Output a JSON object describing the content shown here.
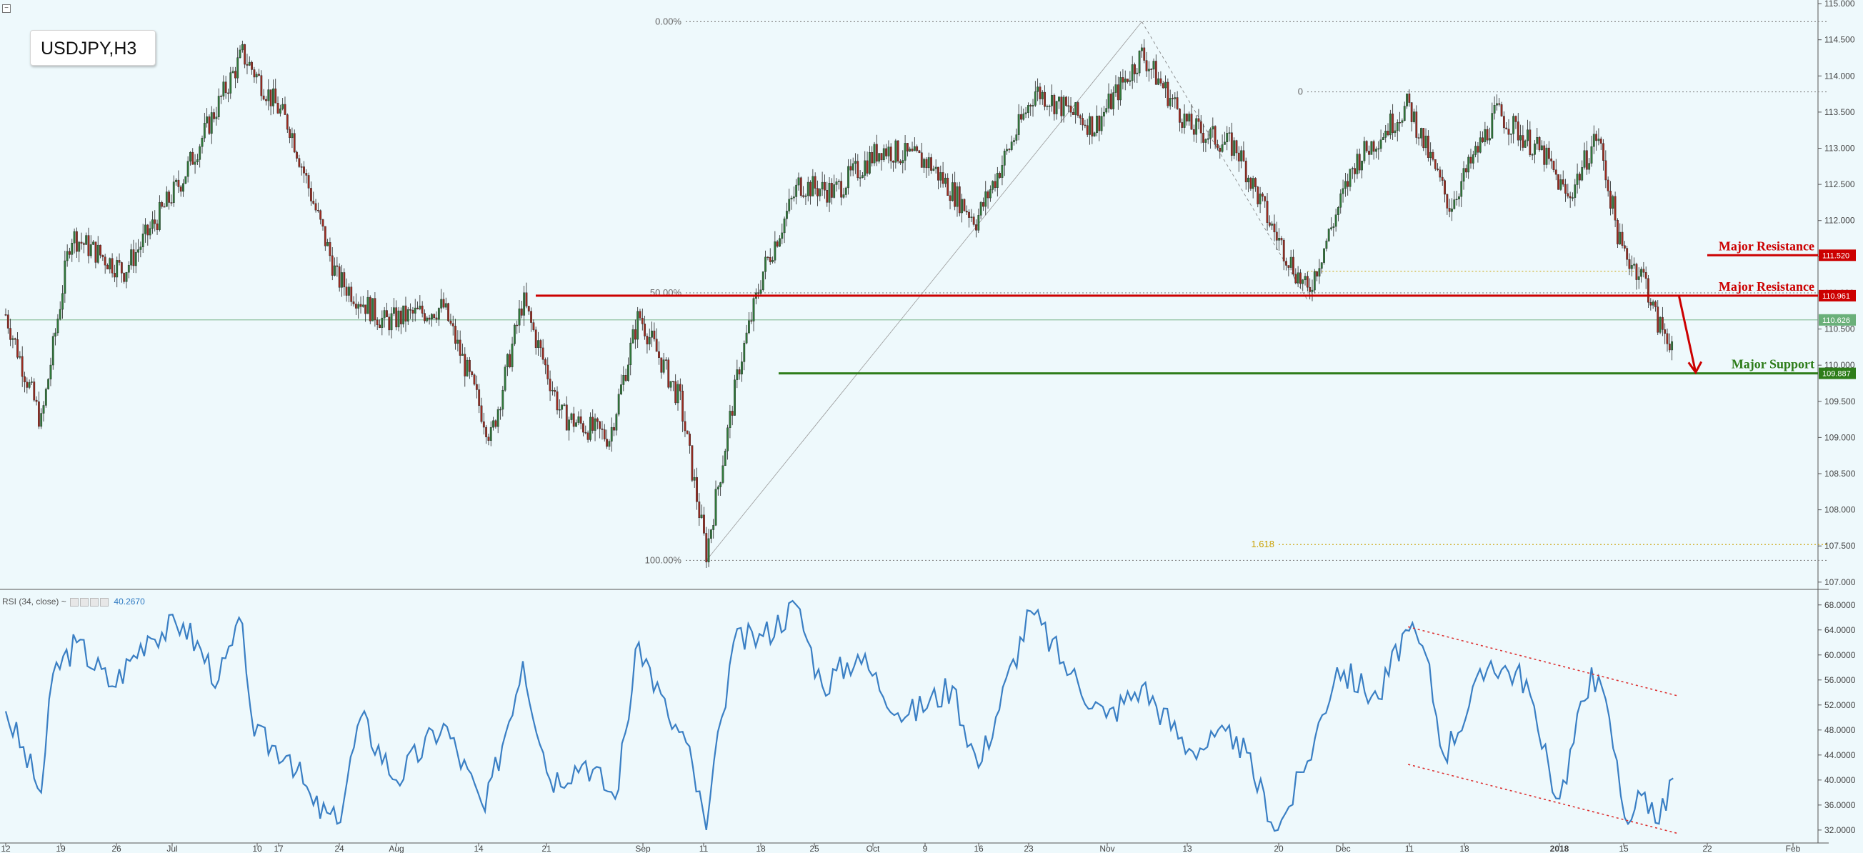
{
  "legend": {
    "symbol": "USDJPY,H3"
  },
  "rsi_panel": {
    "label": "RSI (34, close)",
    "separator": "~",
    "value": "40.2670"
  },
  "colors": {
    "background": "#eef9fc",
    "resistance": "#cc0000",
    "support": "#2e7d1a",
    "fib": "#c9a000",
    "rsi": "#3a7fc4",
    "candle_up": "#2f7a3a",
    "candle_down": "#9c2b20"
  },
  "chart_data": [
    {
      "type": "candlestick",
      "symbol": "USDJPY",
      "timeframe": "H3",
      "ylim": [
        106.85,
        115.05
      ],
      "y_ticks": [
        "115.000",
        "114.500",
        "114.000",
        "113.500",
        "113.000",
        "112.500",
        "112.000",
        "111.500",
        "111.000",
        "110.500",
        "110.000",
        "109.500",
        "109.000",
        "108.500",
        "108.000",
        "107.500",
        "107.000"
      ],
      "x_ticks": [
        "12",
        "19",
        "26",
        "Jul",
        "10",
        "17",
        "24",
        "Aug",
        "14",
        "21",
        "Sep",
        "11",
        "18",
        "25",
        "Oct",
        "9",
        "16",
        "23",
        "Nov",
        "13",
        "20",
        "Dec",
        "11",
        "18",
        "2018",
        "15",
        "22",
        "Feb"
      ],
      "close_series": [
        {
          "x": 0,
          "y": 110.7
        },
        {
          "x": 30,
          "y": 109.2
        },
        {
          "x": 55,
          "y": 111.8
        },
        {
          "x": 100,
          "y": 111.3
        },
        {
          "x": 150,
          "y": 112.6
        },
        {
          "x": 200,
          "y": 114.3
        },
        {
          "x": 240,
          "y": 113.3
        },
        {
          "x": 280,
          "y": 111.2
        },
        {
          "x": 320,
          "y": 110.6
        },
        {
          "x": 370,
          "y": 110.8
        },
        {
          "x": 410,
          "y": 109.0
        },
        {
          "x": 437,
          "y": 110.9
        },
        {
          "x": 470,
          "y": 109.3
        },
        {
          "x": 510,
          "y": 109.0
        },
        {
          "x": 535,
          "y": 110.7
        },
        {
          "x": 570,
          "y": 109.5
        },
        {
          "x": 592,
          "y": 107.4
        },
        {
          "x": 620,
          "y": 110.0
        },
        {
          "x": 640,
          "y": 111.3
        },
        {
          "x": 670,
          "y": 112.5
        },
        {
          "x": 700,
          "y": 112.4
        },
        {
          "x": 740,
          "y": 113.0
        },
        {
          "x": 780,
          "y": 112.8
        },
        {
          "x": 820,
          "y": 112.0
        },
        {
          "x": 870,
          "y": 113.8
        },
        {
          "x": 920,
          "y": 113.3
        },
        {
          "x": 960,
          "y": 114.3
        },
        {
          "x": 1000,
          "y": 113.3
        },
        {
          "x": 1040,
          "y": 113.0
        },
        {
          "x": 1070,
          "y": 111.9
        },
        {
          "x": 1100,
          "y": 111.0
        },
        {
          "x": 1140,
          "y": 112.8
        },
        {
          "x": 1185,
          "y": 113.6
        },
        {
          "x": 1220,
          "y": 112.2
        },
        {
          "x": 1260,
          "y": 113.5
        },
        {
          "x": 1300,
          "y": 112.9
        },
        {
          "x": 1320,
          "y": 112.3
        },
        {
          "x": 1345,
          "y": 113.2
        },
        {
          "x": 1365,
          "y": 111.6
        },
        {
          "x": 1385,
          "y": 111.2
        },
        {
          "x": 1395,
          "y": 110.6
        },
        {
          "x": 1409,
          "y": 110.3
        }
      ],
      "annotations": [
        {
          "text": "Major Resistance",
          "price": 111.52,
          "price_label": "111.520",
          "color": "#cc0000"
        },
        {
          "text": "Major Resistance",
          "price": 110.961,
          "price_label": "110.961",
          "color": "#cc0000"
        },
        {
          "text": "Major Support",
          "price": 109.887,
          "price_label": "109.887",
          "color": "#2e7d1a"
        }
      ],
      "current_price": {
        "price": 110.626,
        "label": "110.626"
      },
      "fibonacci": [
        {
          "label": "0.00%",
          "price": 114.75
        },
        {
          "label": "50.00%",
          "price": 111.0
        },
        {
          "label": "100.00%",
          "price": 107.3
        },
        {
          "label": "0",
          "price": 113.78
        },
        {
          "label": "1.618",
          "price": 107.52
        }
      ],
      "grid": false
    },
    {
      "type": "line",
      "name": "RSI (34, close)",
      "ylim": [
        30.5,
        69.0
      ],
      "y_ticks": [
        "68.0000",
        "64.0000",
        "60.0000",
        "56.0000",
        "52.0000",
        "48.0000",
        "44.0000",
        "40.0000",
        "36.0000",
        "32.0000"
      ],
      "values": [
        {
          "x": 0,
          "y": 51
        },
        {
          "x": 30,
          "y": 38
        },
        {
          "x": 40,
          "y": 57
        },
        {
          "x": 60,
          "y": 62
        },
        {
          "x": 90,
          "y": 55
        },
        {
          "x": 120,
          "y": 63
        },
        {
          "x": 150,
          "y": 65
        },
        {
          "x": 180,
          "y": 56
        },
        {
          "x": 200,
          "y": 65
        },
        {
          "x": 210,
          "y": 47
        },
        {
          "x": 240,
          "y": 44
        },
        {
          "x": 260,
          "y": 36
        },
        {
          "x": 280,
          "y": 33
        },
        {
          "x": 300,
          "y": 50
        },
        {
          "x": 330,
          "y": 40
        },
        {
          "x": 370,
          "y": 49
        },
        {
          "x": 405,
          "y": 35
        },
        {
          "x": 437,
          "y": 59
        },
        {
          "x": 460,
          "y": 40
        },
        {
          "x": 490,
          "y": 43
        },
        {
          "x": 515,
          "y": 37
        },
        {
          "x": 535,
          "y": 62
        },
        {
          "x": 560,
          "y": 50
        },
        {
          "x": 575,
          "y": 46
        },
        {
          "x": 592,
          "y": 32
        },
        {
          "x": 605,
          "y": 50
        },
        {
          "x": 615,
          "y": 62
        },
        {
          "x": 640,
          "y": 63
        },
        {
          "x": 668,
          "y": 68
        },
        {
          "x": 690,
          "y": 55
        },
        {
          "x": 720,
          "y": 60
        },
        {
          "x": 760,
          "y": 50
        },
        {
          "x": 800,
          "y": 55
        },
        {
          "x": 822,
          "y": 42
        },
        {
          "x": 866,
          "y": 67
        },
        {
          "x": 900,
          "y": 57
        },
        {
          "x": 930,
          "y": 50
        },
        {
          "x": 960,
          "y": 55
        },
        {
          "x": 1000,
          "y": 45
        },
        {
          "x": 1040,
          "y": 47
        },
        {
          "x": 1075,
          "y": 32
        },
        {
          "x": 1100,
          "y": 43
        },
        {
          "x": 1125,
          "y": 58
        },
        {
          "x": 1160,
          "y": 53
        },
        {
          "x": 1183,
          "y": 64
        },
        {
          "x": 1200,
          "y": 60
        },
        {
          "x": 1215,
          "y": 44
        },
        {
          "x": 1255,
          "y": 59
        },
        {
          "x": 1285,
          "y": 56
        },
        {
          "x": 1298,
          "y": 45
        },
        {
          "x": 1313,
          "y": 37
        },
        {
          "x": 1340,
          "y": 58
        },
        {
          "x": 1355,
          "y": 50
        },
        {
          "x": 1368,
          "y": 34
        },
        {
          "x": 1385,
          "y": 38
        },
        {
          "x": 1397,
          "y": 33
        },
        {
          "x": 1409,
          "y": 40.27
        }
      ],
      "trendlines": [
        {
          "from": {
            "x": 1185,
            "y": 64.5
          },
          "to": {
            "x": 1412,
            "y": 53.5
          }
        },
        {
          "from": {
            "x": 1185,
            "y": 42.5
          },
          "to": {
            "x": 1412,
            "y": 31.5
          }
        }
      ],
      "grid": false
    }
  ]
}
